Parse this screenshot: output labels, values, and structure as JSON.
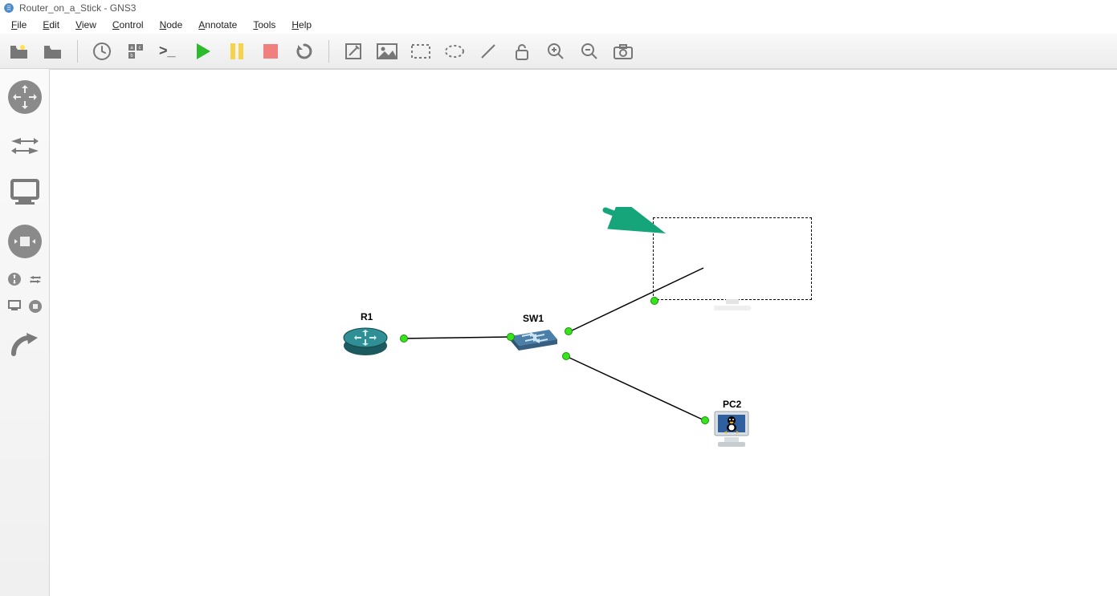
{
  "title": "Router_on_a_Stick - GNS3",
  "menus": {
    "file": "File",
    "edit": "Edit",
    "view": "View",
    "control": "Control",
    "node": "Node",
    "annotate": "Annotate",
    "tools": "Tools",
    "help": "Help"
  },
  "toolbar": {
    "open": "open-project",
    "openfolder": "open-folder",
    "snapshot": "snapshot-time",
    "showlabels": "show-port-labels",
    "console": "console-all",
    "start": "start-all",
    "pause": "suspend-all",
    "stop": "stop-all",
    "reload": "reload-all",
    "note": "add-note",
    "image": "insert-image",
    "rect": "draw-rectangle",
    "ellipse": "draw-ellipse",
    "line": "draw-line",
    "lock": "lock-items",
    "zoomin": "zoom-in",
    "zoomout": "zoom-out",
    "screenshot": "screenshot"
  },
  "dock": {
    "routers": "routers",
    "switches": "switches",
    "enddevices": "end-devices",
    "security": "security-devices",
    "all": "all-devices",
    "link": "add-link",
    "small1": "console",
    "small2": "summary",
    "small3": "grid",
    "small4": "servers"
  },
  "topology": {
    "r1": "R1",
    "sw1": "SW1",
    "pc2": "PC2"
  }
}
